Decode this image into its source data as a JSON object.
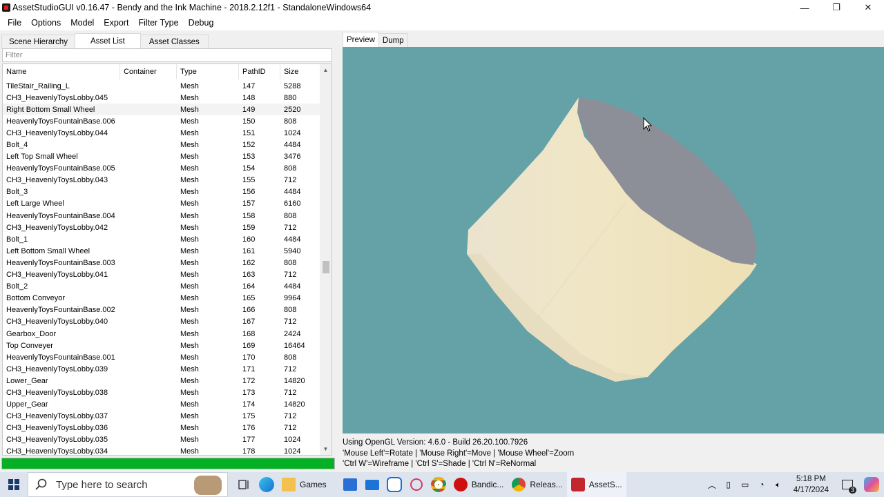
{
  "window": {
    "title": "AssetStudioGUI v0.16.47 - Bendy and the Ink Machine - 2018.2.12f1 - StandaloneWindows64",
    "minimize": "—",
    "maximize": "❐",
    "close": "✕"
  },
  "menu": {
    "items": [
      "File",
      "Options",
      "Model",
      "Export",
      "Filter Type",
      "Debug"
    ]
  },
  "left_tabs": [
    "Scene Hierarchy",
    "Asset List",
    "Asset Classes"
  ],
  "filter": {
    "placeholder": "Filter"
  },
  "asset_list": {
    "columns": [
      "Name",
      "Container",
      "Type",
      "PathID",
      "Size"
    ],
    "rows": [
      {
        "name": "TileStair_Railing_L",
        "container": "",
        "type": "Mesh",
        "pathid": "147",
        "size": "5288"
      },
      {
        "name": "CH3_HeavenlyToysLobby.045",
        "container": "",
        "type": "Mesh",
        "pathid": "148",
        "size": "880"
      },
      {
        "name": "Right Bottom Small Wheel",
        "container": "",
        "type": "Mesh",
        "pathid": "149",
        "size": "2520"
      },
      {
        "name": "HeavenlyToysFountainBase.006",
        "container": "",
        "type": "Mesh",
        "pathid": "150",
        "size": "808"
      },
      {
        "name": "CH3_HeavenlyToysLobby.044",
        "container": "",
        "type": "Mesh",
        "pathid": "151",
        "size": "1024"
      },
      {
        "name": "Bolt_4",
        "container": "",
        "type": "Mesh",
        "pathid": "152",
        "size": "4484"
      },
      {
        "name": "Left Top Small Wheel",
        "container": "",
        "type": "Mesh",
        "pathid": "153",
        "size": "3476"
      },
      {
        "name": "HeavenlyToysFountainBase.005",
        "container": "",
        "type": "Mesh",
        "pathid": "154",
        "size": "808"
      },
      {
        "name": "CH3_HeavenlyToysLobby.043",
        "container": "",
        "type": "Mesh",
        "pathid": "155",
        "size": "712"
      },
      {
        "name": "Bolt_3",
        "container": "",
        "type": "Mesh",
        "pathid": "156",
        "size": "4484"
      },
      {
        "name": "Left Large Wheel",
        "container": "",
        "type": "Mesh",
        "pathid": "157",
        "size": "6160"
      },
      {
        "name": "HeavenlyToysFountainBase.004",
        "container": "",
        "type": "Mesh",
        "pathid": "158",
        "size": "808"
      },
      {
        "name": "CH3_HeavenlyToysLobby.042",
        "container": "",
        "type": "Mesh",
        "pathid": "159",
        "size": "712"
      },
      {
        "name": "Bolt_1",
        "container": "",
        "type": "Mesh",
        "pathid": "160",
        "size": "4484"
      },
      {
        "name": "Left Bottom Small Wheel",
        "container": "",
        "type": "Mesh",
        "pathid": "161",
        "size": "5940"
      },
      {
        "name": "HeavenlyToysFountainBase.003",
        "container": "",
        "type": "Mesh",
        "pathid": "162",
        "size": "808"
      },
      {
        "name": "CH3_HeavenlyToysLobby.041",
        "container": "",
        "type": "Mesh",
        "pathid": "163",
        "size": "712"
      },
      {
        "name": "Bolt_2",
        "container": "",
        "type": "Mesh",
        "pathid": "164",
        "size": "4484"
      },
      {
        "name": "Bottom Conveyor",
        "container": "",
        "type": "Mesh",
        "pathid": "165",
        "size": "9964"
      },
      {
        "name": "HeavenlyToysFountainBase.002",
        "container": "",
        "type": "Mesh",
        "pathid": "166",
        "size": "808"
      },
      {
        "name": "CH3_HeavenlyToysLobby.040",
        "container": "",
        "type": "Mesh",
        "pathid": "167",
        "size": "712"
      },
      {
        "name": "Gearbox_Door",
        "container": "",
        "type": "Mesh",
        "pathid": "168",
        "size": "2424"
      },
      {
        "name": "Top Conveyer",
        "container": "",
        "type": "Mesh",
        "pathid": "169",
        "size": "16464"
      },
      {
        "name": "HeavenlyToysFountainBase.001",
        "container": "",
        "type": "Mesh",
        "pathid": "170",
        "size": "808"
      },
      {
        "name": "CH3_HeavenlyToysLobby.039",
        "container": "",
        "type": "Mesh",
        "pathid": "171",
        "size": "712"
      },
      {
        "name": "Lower_Gear",
        "container": "",
        "type": "Mesh",
        "pathid": "172",
        "size": "14820"
      },
      {
        "name": "CH3_HeavenlyToysLobby.038",
        "container": "",
        "type": "Mesh",
        "pathid": "173",
        "size": "712"
      },
      {
        "name": "Upper_Gear",
        "container": "",
        "type": "Mesh",
        "pathid": "174",
        "size": "14820"
      },
      {
        "name": "CH3_HeavenlyToysLobby.037",
        "container": "",
        "type": "Mesh",
        "pathid": "175",
        "size": "712"
      },
      {
        "name": "CH3_HeavenlyToysLobby.036",
        "container": "",
        "type": "Mesh",
        "pathid": "176",
        "size": "712"
      },
      {
        "name": "CH3_HeavenlyToysLobby.035",
        "container": "",
        "type": "Mesh",
        "pathid": "177",
        "size": "1024"
      },
      {
        "name": "CH3_HeavenlyToysLobby.034",
        "container": "",
        "type": "Mesh",
        "pathid": "178",
        "size": "1024"
      }
    ],
    "selected_index": 2
  },
  "progress": {
    "value": 1.0,
    "color": "#06b025"
  },
  "right_tabs": [
    "Preview",
    "Dump"
  ],
  "preview": {
    "background": "#64a2a7",
    "info_lines": [
      "Using OpenGL Version: 4.6.0 - Build 26.20.100.7926",
      "'Mouse Left'=Rotate | 'Mouse Right'=Move | 'Mouse Wheel'=Zoom",
      "'Ctrl W'=Wireframe | 'Ctrl S'=Shade | 'Ctrl N'=ReNormal"
    ]
  },
  "taskbar": {
    "search_placeholder": "Type here to search",
    "apps": [
      {
        "label": "Games",
        "icon": "folder-icon",
        "color": "#f2c14e"
      },
      {
        "label": "Bandic...",
        "icon": "bandicam-icon",
        "color": "#d01010"
      },
      {
        "label": "Releas...",
        "icon": "chrome-icon",
        "color": "#4285f4"
      },
      {
        "label": "AssetS...",
        "icon": "assetstudio-icon",
        "color": "#c4262e"
      }
    ],
    "notification_count": "3",
    "time": "5:18 PM",
    "date": "4/17/2024"
  }
}
